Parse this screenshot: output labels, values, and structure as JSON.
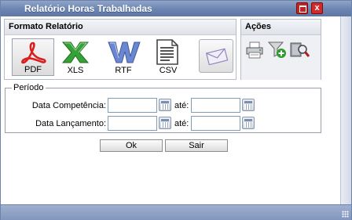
{
  "window": {
    "title": "Relatório Horas Trabalhadas"
  },
  "formats": {
    "header": "Formato Relatório",
    "items": [
      {
        "label": "PDF",
        "icon": "pdf-icon"
      },
      {
        "label": "XLS",
        "icon": "excel-icon"
      },
      {
        "label": "RTF",
        "icon": "word-icon"
      },
      {
        "label": "CSV",
        "icon": "text-file-icon"
      },
      {
        "label": "",
        "icon": "email-icon"
      }
    ]
  },
  "actions": {
    "header": "Ações",
    "icons": [
      "printer-icon",
      "filter-add-icon",
      "search-icon"
    ]
  },
  "periodo": {
    "legend": "Período",
    "competencia_label": "Data Competência:",
    "lancamento_label": "Data Lançamento:",
    "ate_label": "até:"
  },
  "buttons": {
    "ok": "Ok",
    "sair": "Sair"
  },
  "colors": {
    "titlebar": "#6e86b2",
    "close": "#d22a2a",
    "pdf_red": "#d81e1e",
    "xls_green": "#2e8b2e",
    "rtf_blue": "#5575c2"
  }
}
